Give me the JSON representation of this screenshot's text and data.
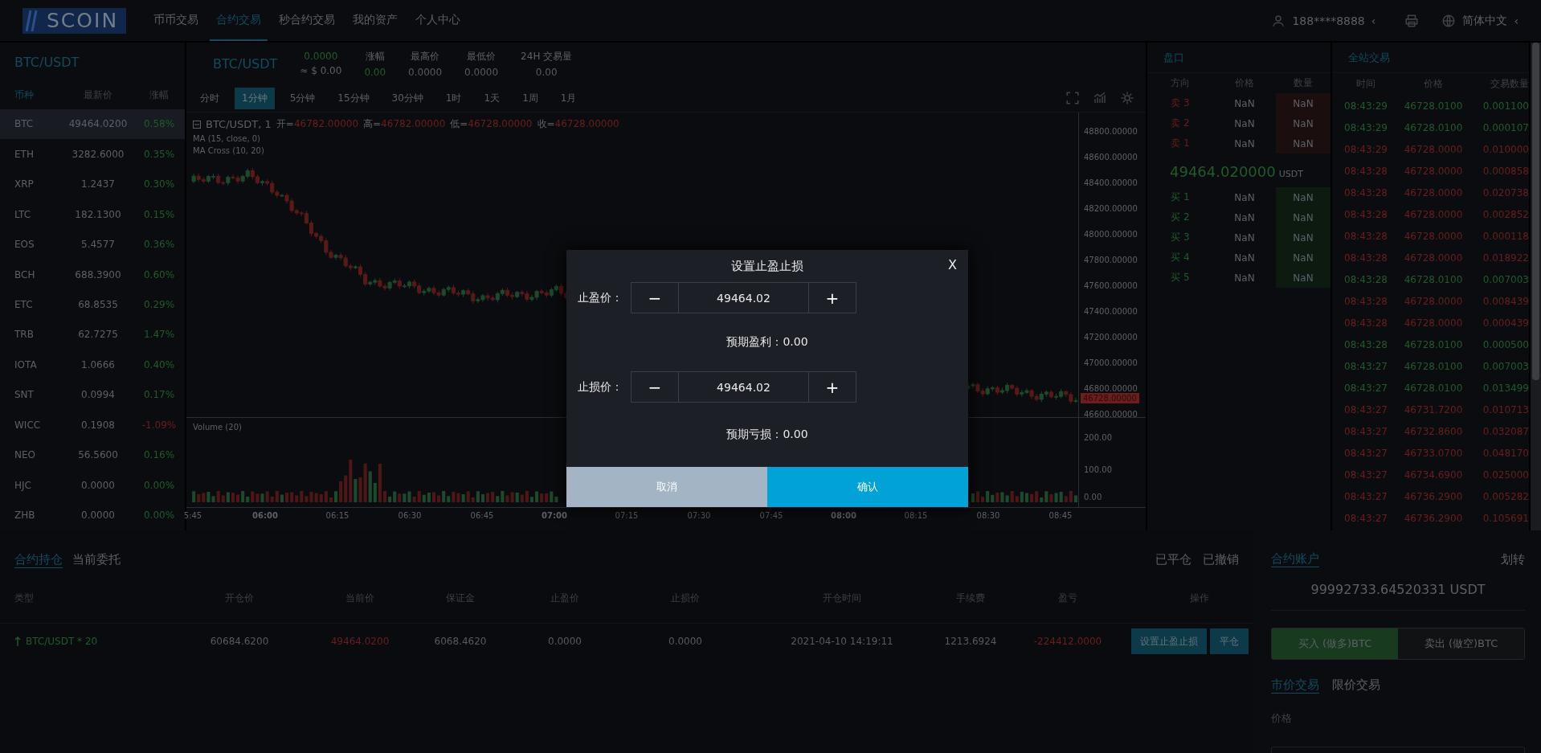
{
  "nav": {
    "logo": "SCOIN",
    "items": [
      {
        "label": "币币交易",
        "selected": false
      },
      {
        "label": "合约交易",
        "selected": true
      },
      {
        "label": "秒合约交易",
        "selected": false
      },
      {
        "label": "我的资产",
        "selected": false
      },
      {
        "label": "个人中心",
        "selected": false
      }
    ],
    "user": "188****8888",
    "user_chevron": "‹",
    "language": "简体中文",
    "language_chevron": "‹"
  },
  "market_list": {
    "title": "BTC/USDT",
    "columns": [
      {
        "label": "币种",
        "selected": true
      },
      {
        "label": "最新价",
        "selected": false
      },
      {
        "label": "涨幅",
        "selected": false
      }
    ],
    "rows": [
      {
        "symbol": "BTC",
        "price": "49464.0200",
        "change": "0.58%",
        "positive": true,
        "selected": true
      },
      {
        "symbol": "ETH",
        "price": "3282.6000",
        "change": "0.35%",
        "positive": true,
        "selected": false
      },
      {
        "symbol": "XRP",
        "price": "1.2437",
        "change": "0.30%",
        "positive": true,
        "selected": false
      },
      {
        "symbol": "LTC",
        "price": "182.1300",
        "change": "0.15%",
        "positive": true,
        "selected": false
      },
      {
        "symbol": "EOS",
        "price": "5.4577",
        "change": "0.36%",
        "positive": true,
        "selected": false
      },
      {
        "symbol": "BCH",
        "price": "688.3900",
        "change": "0.60%",
        "positive": true,
        "selected": false
      },
      {
        "symbol": "ETC",
        "price": "68.8535",
        "change": "0.29%",
        "positive": true,
        "selected": false
      },
      {
        "symbol": "TRB",
        "price": "62.7275",
        "change": "1.47%",
        "positive": true,
        "selected": false
      },
      {
        "symbol": "IOTA",
        "price": "1.0666",
        "change": "0.40%",
        "positive": true,
        "selected": false
      },
      {
        "symbol": "SNT",
        "price": "0.0994",
        "change": "0.17%",
        "positive": true,
        "selected": false
      },
      {
        "symbol": "WICC",
        "price": "0.1908",
        "change": "-1.09%",
        "positive": false,
        "selected": false
      },
      {
        "symbol": "NEO",
        "price": "56.5600",
        "change": "0.16%",
        "positive": true,
        "selected": false
      },
      {
        "symbol": "HJC",
        "price": "0.0000",
        "change": "0.00%",
        "positive": true,
        "selected": false
      },
      {
        "symbol": "ZHB",
        "price": "0.0000",
        "change": "0.00%",
        "positive": true,
        "selected": false
      }
    ]
  },
  "chart": {
    "pair": "BTC/USDT",
    "last": "0.0000",
    "usd": "≈ $ 0.00",
    "stats": [
      {
        "label": "涨幅",
        "value": "0.00",
        "positive": true
      },
      {
        "label": "最高价",
        "value": "0.0000",
        "positive": false
      },
      {
        "label": "最低价",
        "value": "0.0000",
        "positive": false
      },
      {
        "label": "24H 交易量",
        "value": "0.00",
        "positive": false
      }
    ],
    "intervals": [
      {
        "label": "分时",
        "selected": false
      },
      {
        "label": "1分钟",
        "selected": true
      },
      {
        "label": "5分钟",
        "selected": false
      },
      {
        "label": "15分钟",
        "selected": false
      },
      {
        "label": "30分钟",
        "selected": false
      },
      {
        "label": "1时",
        "selected": false
      },
      {
        "label": "1天",
        "selected": false
      },
      {
        "label": "1周",
        "selected": false
      },
      {
        "label": "1月",
        "selected": false
      }
    ],
    "legend": {
      "title": "BTC/USDT, 1",
      "ohlc": [
        {
          "label": "开=",
          "value": "46782.00000"
        },
        {
          "label": "高=",
          "value": "46782.00000"
        },
        {
          "label": "低=",
          "value": "46728.00000"
        },
        {
          "label": "收=",
          "value": "46728.00000"
        }
      ],
      "indicators": [
        "MA (15, close, 0)",
        "MA Cross (10, 20)"
      ],
      "volume_label": "Volume (20)"
    },
    "price_ticks": [
      "48800.00000",
      "48600.00000",
      "48400.00000",
      "48200.00000",
      "48000.00000",
      "47800.00000",
      "47600.00000",
      "47400.00000",
      "47200.00000",
      "47000.00000",
      "46800.00000",
      "46600.00000"
    ],
    "last_price_tag": "46728.00000",
    "volume_ticks": [
      "200.00",
      "100.00",
      "0.00"
    ],
    "time_ticks": [
      {
        "label": "5:45",
        "bold": false
      },
      {
        "label": "06:00",
        "bold": true
      },
      {
        "label": "06:15",
        "bold": false
      },
      {
        "label": "06:30",
        "bold": false
      },
      {
        "label": "06:45",
        "bold": false
      },
      {
        "label": "07:00",
        "bold": true
      },
      {
        "label": "07:15",
        "bold": false
      },
      {
        "label": "07:30",
        "bold": false
      },
      {
        "label": "07:45",
        "bold": false
      },
      {
        "label": "08:00",
        "bold": true
      },
      {
        "label": "08:15",
        "bold": false
      },
      {
        "label": "08:30",
        "bold": false
      },
      {
        "label": "08:45",
        "bold": false
      }
    ]
  },
  "order_book": {
    "title": "盘口",
    "columns": [
      "方向",
      "价格",
      "数量"
    ],
    "asks": [
      {
        "side": "卖 3",
        "price": "NaN",
        "amount": "NaN"
      },
      {
        "side": "卖 2",
        "price": "NaN",
        "amount": "NaN"
      },
      {
        "side": "卖 1",
        "price": "NaN",
        "amount": "NaN"
      }
    ],
    "mid_price": "49464.020000",
    "mid_unit": "USDT",
    "bids": [
      {
        "side": "买 1",
        "price": "NaN",
        "amount": "NaN"
      },
      {
        "side": "买 2",
        "price": "NaN",
        "amount": "NaN"
      },
      {
        "side": "买 3",
        "price": "NaN",
        "amount": "NaN"
      },
      {
        "side": "买 4",
        "price": "NaN",
        "amount": "NaN"
      },
      {
        "side": "买 5",
        "price": "NaN",
        "amount": "NaN"
      }
    ]
  },
  "trades": {
    "title": "全站交易",
    "columns": [
      "时间",
      "价格",
      "交易数量"
    ],
    "rows": [
      {
        "time": "08:43:29",
        "price": "46728.0100",
        "amount": "0.001100",
        "buy": true
      },
      {
        "time": "08:43:29",
        "price": "46728.0100",
        "amount": "0.000107",
        "buy": true
      },
      {
        "time": "08:43:29",
        "price": "46728.0000",
        "amount": "0.010000",
        "buy": false
      },
      {
        "time": "08:43:28",
        "price": "46728.0000",
        "amount": "0.000858",
        "buy": false
      },
      {
        "time": "08:43:28",
        "price": "46728.0000",
        "amount": "0.020738",
        "buy": false
      },
      {
        "time": "08:43:28",
        "price": "46728.0000",
        "amount": "0.002852",
        "buy": false
      },
      {
        "time": "08:43:28",
        "price": "46728.0000",
        "amount": "0.000118",
        "buy": false
      },
      {
        "time": "08:43:28",
        "price": "46728.0000",
        "amount": "0.018922",
        "buy": false
      },
      {
        "time": "08:43:28",
        "price": "46728.0100",
        "amount": "0.007003",
        "buy": true
      },
      {
        "time": "08:43:28",
        "price": "46728.0000",
        "amount": "0.008439",
        "buy": false
      },
      {
        "time": "08:43:28",
        "price": "46728.0000",
        "amount": "0.000439",
        "buy": false
      },
      {
        "time": "08:43:28",
        "price": "46728.0100",
        "amount": "0.000500",
        "buy": true
      },
      {
        "time": "08:43:27",
        "price": "46728.0100",
        "amount": "0.007003",
        "buy": true
      },
      {
        "time": "08:43:27",
        "price": "46728.0100",
        "amount": "0.013499",
        "buy": true
      },
      {
        "time": "08:43:27",
        "price": "46731.7200",
        "amount": "0.010713",
        "buy": false
      },
      {
        "time": "08:43:27",
        "price": "46732.8600",
        "amount": "0.032087",
        "buy": false
      },
      {
        "time": "08:43:27",
        "price": "46733.0700",
        "amount": "0.048170",
        "buy": false
      },
      {
        "time": "08:43:27",
        "price": "46734.6900",
        "amount": "0.025000",
        "buy": false
      },
      {
        "time": "08:43:27",
        "price": "46736.2900",
        "amount": "0.005282",
        "buy": false
      },
      {
        "time": "08:43:27",
        "price": "46736.2900",
        "amount": "0.105691",
        "buy": false
      }
    ]
  },
  "positions": {
    "tabs": [
      {
        "label": "合约持仓",
        "selected": true
      },
      {
        "label": "当前委托",
        "selected": false
      }
    ],
    "filters": [
      "已平仓",
      "已撤销"
    ],
    "columns": [
      "类型",
      "开仓价",
      "当前价",
      "保证金",
      "止盈价",
      "止损价",
      "开仓时间",
      "手续费",
      "盈亏",
      "操作"
    ],
    "rows": [
      {
        "long": true,
        "cells": [
          {
            "text": "BTC/USDT * 20",
            "kind": "type"
          },
          {
            "text": "60684.6200",
            "kind": "plain"
          },
          {
            "text": "49464.0200",
            "kind": "loss"
          },
          {
            "text": "6068.4620",
            "kind": "plain"
          },
          {
            "text": "0.0000",
            "kind": "plain"
          },
          {
            "text": "0.0000",
            "kind": "plain"
          },
          {
            "text": "2021-04-10 14:19:11",
            "kind": "plain"
          },
          {
            "text": "1213.6924",
            "kind": "plain"
          },
          {
            "text": "-224412.0000",
            "kind": "loss"
          }
        ],
        "actions": [
          "设置止盈止损",
          "平仓"
        ]
      }
    ]
  },
  "account": {
    "tab": {
      "label": "合约账户",
      "selected": true
    },
    "transfer": "划转",
    "balance": "99992733.64520331 USDT",
    "sides": [
      {
        "label": "买入 (做多)BTC",
        "selected": true
      },
      {
        "label": "卖出 (做空)BTC",
        "selected": false
      }
    ],
    "order_types": [
      {
        "label": "市价交易",
        "selected": true
      },
      {
        "label": "限价交易",
        "selected": false
      }
    ],
    "price_label": "价格"
  },
  "modal": {
    "title": "设置止盈止损",
    "close": "X",
    "fields": [
      {
        "label": "止盈价：",
        "minus": "−",
        "value": "49464.02",
        "plus": "+",
        "expected": "预期盈利：0.00"
      },
      {
        "label": "止损价：",
        "minus": "−",
        "value": "49464.02",
        "plus": "+",
        "expected": "预期亏损：0.00"
      }
    ],
    "buttons": [
      {
        "label": "取消",
        "kind": "cancel"
      },
      {
        "label": "确认",
        "kind": "confirm"
      }
    ]
  }
}
